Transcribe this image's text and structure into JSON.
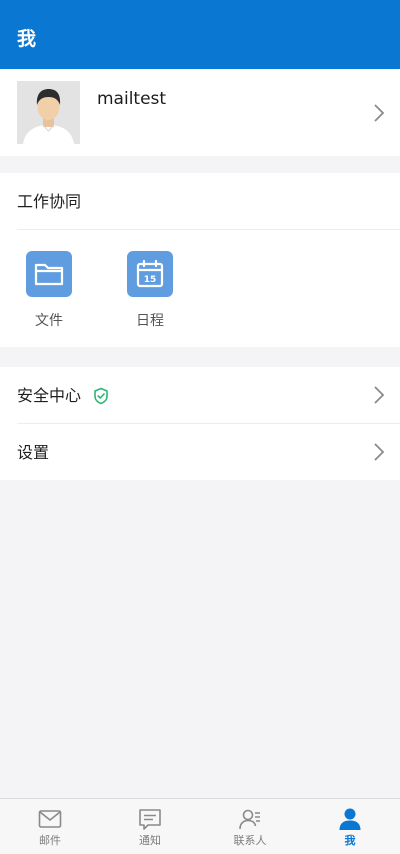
{
  "header": {
    "title": "我"
  },
  "profile": {
    "username": "mailtest"
  },
  "work": {
    "title": "工作协同",
    "tiles": [
      {
        "label": "文件",
        "icon": "folder-icon"
      },
      {
        "label": "日程",
        "icon": "calendar-icon",
        "day": "15"
      }
    ]
  },
  "menu": {
    "items": [
      {
        "label": "安全中心",
        "icon": "shield-check-icon"
      },
      {
        "label": "设置"
      }
    ]
  },
  "tabbar": {
    "items": [
      {
        "label": "邮件",
        "icon": "mail-icon"
      },
      {
        "label": "通知",
        "icon": "notification-icon"
      },
      {
        "label": "联系人",
        "icon": "contacts-icon"
      },
      {
        "label": "我",
        "icon": "person-icon",
        "active": true
      }
    ]
  },
  "colors": {
    "accent": "#0a77d3",
    "tile": "#5f9de0",
    "shield": "#2bb673",
    "background": "#f4f3f6"
  }
}
